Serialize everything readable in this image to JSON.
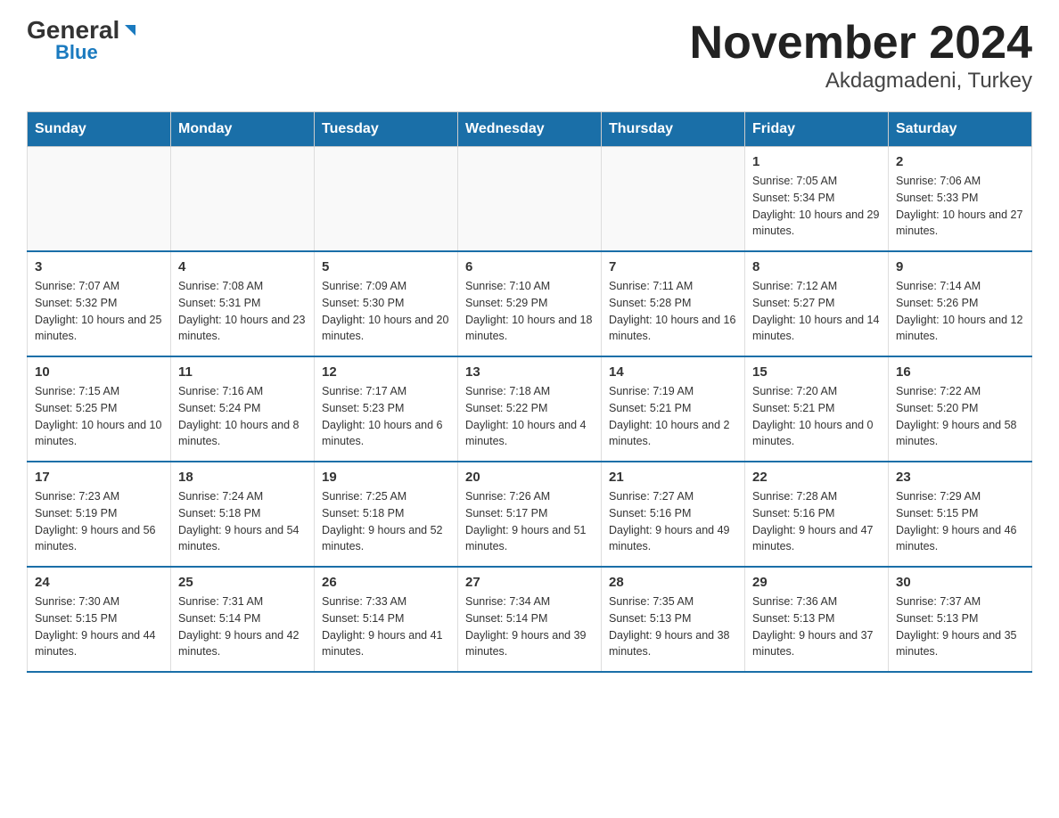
{
  "header": {
    "logo_general": "General",
    "logo_blue": "Blue",
    "title": "November 2024",
    "subtitle": "Akdagmadeni, Turkey"
  },
  "days_of_week": [
    "Sunday",
    "Monday",
    "Tuesday",
    "Wednesday",
    "Thursday",
    "Friday",
    "Saturday"
  ],
  "weeks": [
    [
      {
        "day": "",
        "info": ""
      },
      {
        "day": "",
        "info": ""
      },
      {
        "day": "",
        "info": ""
      },
      {
        "day": "",
        "info": ""
      },
      {
        "day": "",
        "info": ""
      },
      {
        "day": "1",
        "info": "Sunrise: 7:05 AM\nSunset: 5:34 PM\nDaylight: 10 hours and 29 minutes."
      },
      {
        "day": "2",
        "info": "Sunrise: 7:06 AM\nSunset: 5:33 PM\nDaylight: 10 hours and 27 minutes."
      }
    ],
    [
      {
        "day": "3",
        "info": "Sunrise: 7:07 AM\nSunset: 5:32 PM\nDaylight: 10 hours and 25 minutes."
      },
      {
        "day": "4",
        "info": "Sunrise: 7:08 AM\nSunset: 5:31 PM\nDaylight: 10 hours and 23 minutes."
      },
      {
        "day": "5",
        "info": "Sunrise: 7:09 AM\nSunset: 5:30 PM\nDaylight: 10 hours and 20 minutes."
      },
      {
        "day": "6",
        "info": "Sunrise: 7:10 AM\nSunset: 5:29 PM\nDaylight: 10 hours and 18 minutes."
      },
      {
        "day": "7",
        "info": "Sunrise: 7:11 AM\nSunset: 5:28 PM\nDaylight: 10 hours and 16 minutes."
      },
      {
        "day": "8",
        "info": "Sunrise: 7:12 AM\nSunset: 5:27 PM\nDaylight: 10 hours and 14 minutes."
      },
      {
        "day": "9",
        "info": "Sunrise: 7:14 AM\nSunset: 5:26 PM\nDaylight: 10 hours and 12 minutes."
      }
    ],
    [
      {
        "day": "10",
        "info": "Sunrise: 7:15 AM\nSunset: 5:25 PM\nDaylight: 10 hours and 10 minutes."
      },
      {
        "day": "11",
        "info": "Sunrise: 7:16 AM\nSunset: 5:24 PM\nDaylight: 10 hours and 8 minutes."
      },
      {
        "day": "12",
        "info": "Sunrise: 7:17 AM\nSunset: 5:23 PM\nDaylight: 10 hours and 6 minutes."
      },
      {
        "day": "13",
        "info": "Sunrise: 7:18 AM\nSunset: 5:22 PM\nDaylight: 10 hours and 4 minutes."
      },
      {
        "day": "14",
        "info": "Sunrise: 7:19 AM\nSunset: 5:21 PM\nDaylight: 10 hours and 2 minutes."
      },
      {
        "day": "15",
        "info": "Sunrise: 7:20 AM\nSunset: 5:21 PM\nDaylight: 10 hours and 0 minutes."
      },
      {
        "day": "16",
        "info": "Sunrise: 7:22 AM\nSunset: 5:20 PM\nDaylight: 9 hours and 58 minutes."
      }
    ],
    [
      {
        "day": "17",
        "info": "Sunrise: 7:23 AM\nSunset: 5:19 PM\nDaylight: 9 hours and 56 minutes."
      },
      {
        "day": "18",
        "info": "Sunrise: 7:24 AM\nSunset: 5:18 PM\nDaylight: 9 hours and 54 minutes."
      },
      {
        "day": "19",
        "info": "Sunrise: 7:25 AM\nSunset: 5:18 PM\nDaylight: 9 hours and 52 minutes."
      },
      {
        "day": "20",
        "info": "Sunrise: 7:26 AM\nSunset: 5:17 PM\nDaylight: 9 hours and 51 minutes."
      },
      {
        "day": "21",
        "info": "Sunrise: 7:27 AM\nSunset: 5:16 PM\nDaylight: 9 hours and 49 minutes."
      },
      {
        "day": "22",
        "info": "Sunrise: 7:28 AM\nSunset: 5:16 PM\nDaylight: 9 hours and 47 minutes."
      },
      {
        "day": "23",
        "info": "Sunrise: 7:29 AM\nSunset: 5:15 PM\nDaylight: 9 hours and 46 minutes."
      }
    ],
    [
      {
        "day": "24",
        "info": "Sunrise: 7:30 AM\nSunset: 5:15 PM\nDaylight: 9 hours and 44 minutes."
      },
      {
        "day": "25",
        "info": "Sunrise: 7:31 AM\nSunset: 5:14 PM\nDaylight: 9 hours and 42 minutes."
      },
      {
        "day": "26",
        "info": "Sunrise: 7:33 AM\nSunset: 5:14 PM\nDaylight: 9 hours and 41 minutes."
      },
      {
        "day": "27",
        "info": "Sunrise: 7:34 AM\nSunset: 5:14 PM\nDaylight: 9 hours and 39 minutes."
      },
      {
        "day": "28",
        "info": "Sunrise: 7:35 AM\nSunset: 5:13 PM\nDaylight: 9 hours and 38 minutes."
      },
      {
        "day": "29",
        "info": "Sunrise: 7:36 AM\nSunset: 5:13 PM\nDaylight: 9 hours and 37 minutes."
      },
      {
        "day": "30",
        "info": "Sunrise: 7:37 AM\nSunset: 5:13 PM\nDaylight: 9 hours and 35 minutes."
      }
    ]
  ]
}
